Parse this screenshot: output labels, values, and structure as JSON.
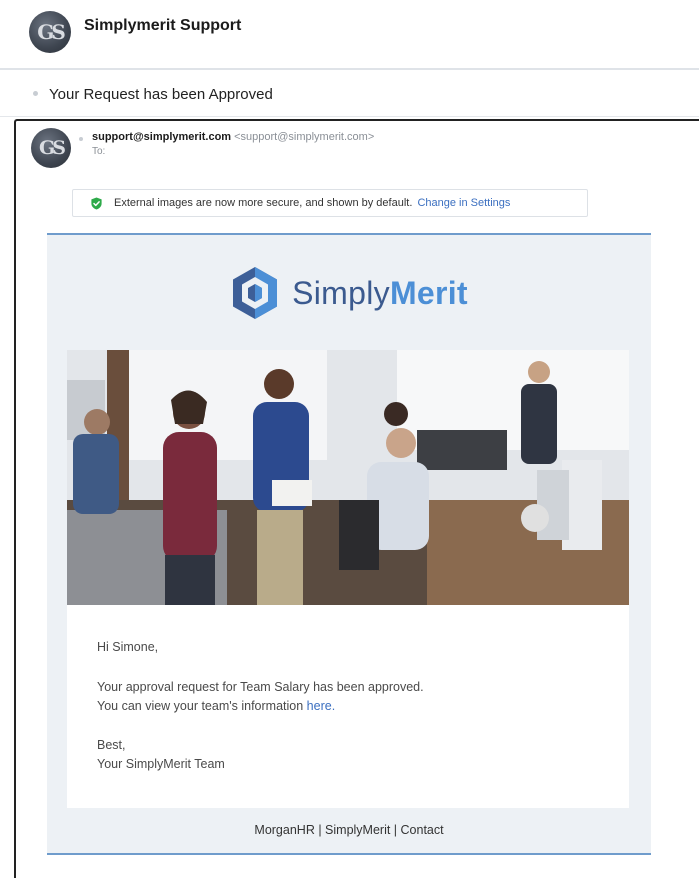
{
  "header": {
    "avatar_initials": "GS",
    "sender_name": "Simplymerit Support"
  },
  "subject": "Your Request has been Approved",
  "message": {
    "avatar_initials": "GS",
    "from_email": "support@simplymerit.com",
    "from_email_display": "<support@simplymerit.com>",
    "to_label": "To:"
  },
  "notice": {
    "text": "External images are now more secure, and shown by default.",
    "link": "Change in Settings",
    "icon": "shield-check-icon",
    "icon_color": "#2eaa4a"
  },
  "email": {
    "logo_part1": "Simply",
    "logo_part2": "Merit",
    "greeting": "Hi Simone,",
    "body_line1": "Your approval request for Team Salary has been approved.",
    "body_line2_prefix": "You can view your team's information ",
    "body_link": "here.",
    "signoff": "Best,",
    "signature": "Your SimplyMerit Team",
    "footer": "MorganHR | SimplyMerit | Contact"
  },
  "colors": {
    "accent_blue": "#4c8fd6",
    "logo_dark": "#3b5a8f",
    "link": "#3b6fc0",
    "email_bg": "#edf1f5"
  }
}
